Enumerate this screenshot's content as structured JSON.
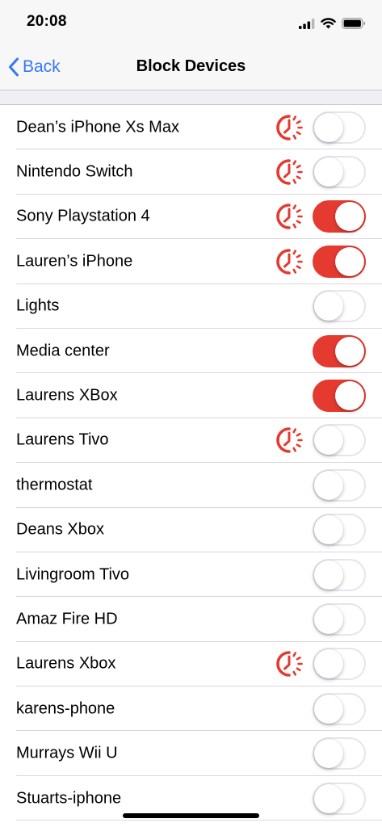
{
  "status_bar": {
    "time": "20:08",
    "icons": [
      "cellular-signal-icon",
      "wifi-icon",
      "battery-icon"
    ]
  },
  "nav": {
    "back_label": "Back",
    "title": "Block Devices"
  },
  "colors": {
    "accent_blue": "#3478f6",
    "toggle_on_red": "#e53a30",
    "schedule_red": "#e53a30"
  },
  "devices": [
    {
      "name": "Dean’s iPhone Xs Max",
      "scheduled": true,
      "blocked": false
    },
    {
      "name": "Nintendo Switch",
      "scheduled": true,
      "blocked": false
    },
    {
      "name": "Sony Playstation 4",
      "scheduled": true,
      "blocked": true
    },
    {
      "name": "Lauren’s iPhone",
      "scheduled": true,
      "blocked": true
    },
    {
      "name": "Lights",
      "scheduled": false,
      "blocked": false
    },
    {
      "name": "Media center",
      "scheduled": false,
      "blocked": true
    },
    {
      "name": "Laurens XBox",
      "scheduled": false,
      "blocked": true
    },
    {
      "name": "Laurens Tivo",
      "scheduled": true,
      "blocked": false
    },
    {
      "name": "thermostat",
      "scheduled": false,
      "blocked": false
    },
    {
      "name": "Deans Xbox",
      "scheduled": false,
      "blocked": false
    },
    {
      "name": "Livingroom Tivo",
      "scheduled": false,
      "blocked": false
    },
    {
      "name": "Amaz Fire HD",
      "scheduled": false,
      "blocked": false
    },
    {
      "name": "Laurens Xbox",
      "scheduled": true,
      "blocked": false
    },
    {
      "name": "karens-phone",
      "scheduled": false,
      "blocked": false
    },
    {
      "name": "Murrays Wii U",
      "scheduled": false,
      "blocked": false
    },
    {
      "name": "Stuarts-iphone",
      "scheduled": false,
      "blocked": false
    }
  ]
}
